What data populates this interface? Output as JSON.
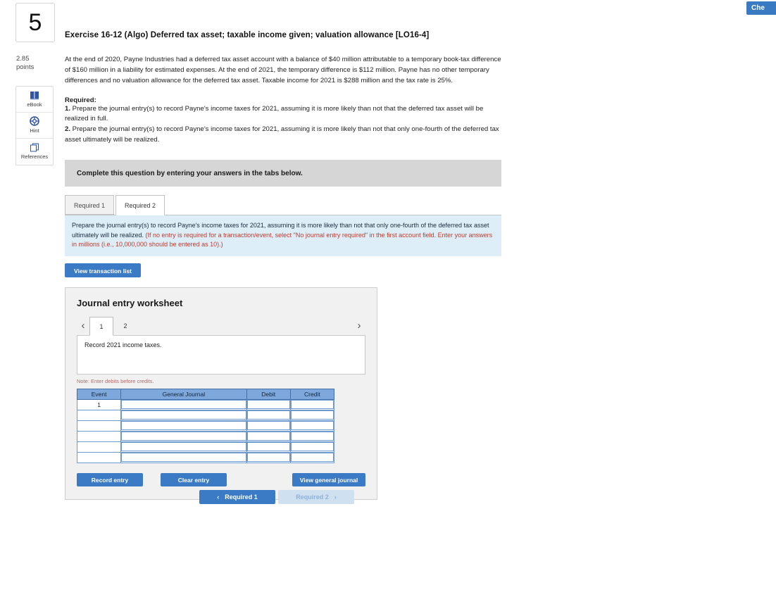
{
  "check_work": {
    "label": "Che"
  },
  "sidebar": {
    "question_number": "5",
    "points_value": "2.85",
    "points_label": "points",
    "tools": [
      {
        "label": "eBook",
        "icon": "book-icon"
      },
      {
        "label": "Hint",
        "icon": "lifebuoy-icon"
      },
      {
        "label": "References",
        "icon": "pages-icon"
      }
    ]
  },
  "exercise": {
    "title": "Exercise 16-12 (Algo) Deferred tax asset; taxable income given; valuation allowance [LO16-4]",
    "paragraph": "At the end of 2020, Payne Industries had a deferred tax asset account with a balance of $40 million attributable to a temporary book-tax difference of $160 million in a liability for estimated expenses. At the end of 2021, the temporary difference is $112 million. Payne has no other temporary differences and no valuation allowance for the deferred tax asset. Taxable income for 2021 is $288 million and the tax rate is 25%.",
    "required_heading": "Required:",
    "requirement_1_num": "1.",
    "requirement_1": " Prepare the journal entry(s) to record Payne's income taxes for 2021, assuming it is more likely than not that the deferred tax asset will be realized in full.",
    "requirement_2_num": "2.",
    "requirement_2": " Prepare the journal entry(s) to record Payne's income taxes for 2021, assuming it is more likely than not that only one-fourth of the deferred tax asset ultimately will be realized."
  },
  "complete_bar": {
    "text": "Complete this question by entering your answers in the tabs below."
  },
  "tabs": [
    {
      "label": "Required 1",
      "active": false
    },
    {
      "label": "Required 2",
      "active": true
    }
  ],
  "instruction": {
    "main": "Prepare the journal entry(s) to record Payne's income taxes for 2021, assuming it is more likely than not that only one-fourth of the deferred tax asset ultimately will be realized. ",
    "red": "(If no entry is required for a transaction/event, select \"No journal entry required\" in the first account field. Enter your answers in millions (i.e., 10,000,000 should be entered as 10).)"
  },
  "view_transaction_list": {
    "label": "View transaction list"
  },
  "worksheet": {
    "title": "Journal entry worksheet",
    "pages": [
      {
        "label": "1",
        "active": true
      },
      {
        "label": "2",
        "active": false
      }
    ],
    "prev_icon": "chevron-left-icon",
    "next_icon": "chevron-right-icon",
    "description": "Record 2021 income taxes.",
    "note": "Note: Enter debits before credits.",
    "table": {
      "headers": [
        "Event",
        "General Journal",
        "Debit",
        "Credit"
      ],
      "rows": [
        {
          "event": "1",
          "general_journal": "",
          "debit": "",
          "credit": ""
        },
        {
          "event": "",
          "general_journal": "",
          "debit": "",
          "credit": ""
        },
        {
          "event": "",
          "general_journal": "",
          "debit": "",
          "credit": ""
        },
        {
          "event": "",
          "general_journal": "",
          "debit": "",
          "credit": ""
        },
        {
          "event": "",
          "general_journal": "",
          "debit": "",
          "credit": ""
        },
        {
          "event": "",
          "general_journal": "",
          "debit": "",
          "credit": ""
        }
      ]
    },
    "actions": {
      "record_entry": "Record entry",
      "clear_entry": "Clear entry",
      "view_general_journal": "View general journal"
    }
  },
  "bottom_nav": {
    "prev_label": "Required 1",
    "next_label": "Required 2",
    "prev_icon": "chevron-left-icon",
    "next_icon": "chevron-right-icon"
  },
  "colors": {
    "accent_blue": "#3b7ac4",
    "table_header_blue": "#7ea8dc",
    "instruction_bg": "#ddeef8",
    "complete_bar_bg": "#d6d6d6",
    "red_text": "#c0392b"
  }
}
